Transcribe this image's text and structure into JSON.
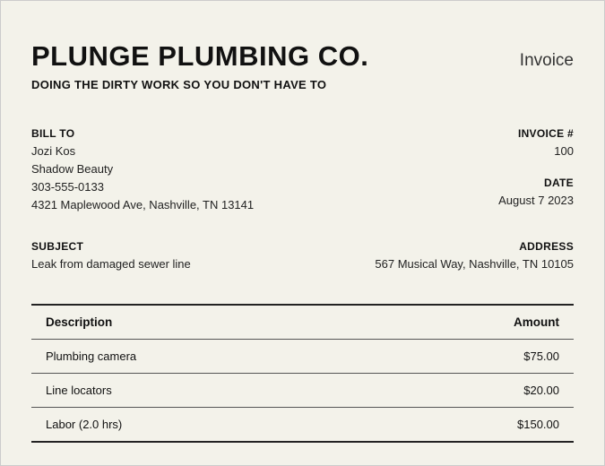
{
  "header": {
    "company_name": "PLUNGE PLUMBING CO.",
    "doc_type": "Invoice",
    "tagline": "DOING THE DIRTY WORK SO YOU DON'T HAVE TO"
  },
  "bill_to": {
    "label": "BILL TO",
    "name": "Jozi Kos",
    "company": "Shadow Beauty",
    "phone": "303-555-0133",
    "address": "4321 Maplewood Ave, Nashville, TN 13141"
  },
  "invoice": {
    "number_label": "INVOICE #",
    "number": "100",
    "date_label": "DATE",
    "date": "August 7 2023"
  },
  "subject": {
    "label": "SUBJECT",
    "text": "Leak from damaged sewer line"
  },
  "service_address": {
    "label": "ADDRESS",
    "text": "567 Musical Way, Nashville, TN 10105"
  },
  "table": {
    "headers": {
      "description": "Description",
      "amount": "Amount"
    },
    "rows": [
      {
        "description": "Plumbing camera",
        "amount": "$75.00"
      },
      {
        "description": "Line locators",
        "amount": "$20.00"
      },
      {
        "description": "Labor (2.0 hrs)",
        "amount": "$150.00"
      }
    ]
  }
}
